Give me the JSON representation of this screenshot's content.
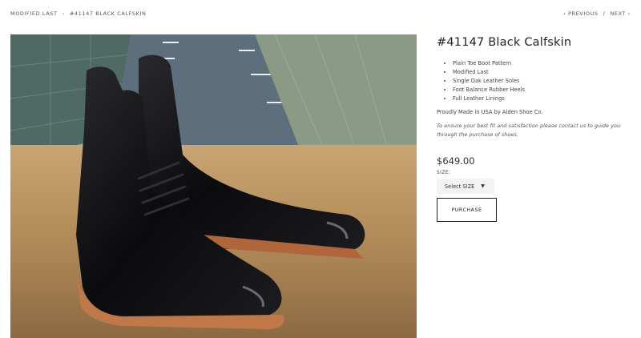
{
  "breadcrumb": {
    "parent": "MODIFIED LAST",
    "separator": "›",
    "current": "#41147 BLACK CALFSKIN"
  },
  "pager": {
    "previous": "‹ PREVIOUS",
    "separator": "/",
    "next": "NEXT ›"
  },
  "product": {
    "title": "#41147 Black Calfskin",
    "features": [
      "Plain Toe Boot Pattern",
      "Modified Last",
      "Single Oak Leather Soles",
      "Foot Balance Rubber Heels",
      "Full Leather Linings"
    ],
    "made_in": "Proudly Made in USA by Alden Shoe Co.",
    "note": "To ensure your best fit and satisfaction please contact us to guide you through the purchase of shoes.",
    "price": "$649.00",
    "size_label": "SIZE:",
    "size_select": "Select SIZE",
    "purchase_label": "PURCHASE"
  },
  "icons": {
    "dropdown": "caret-down-icon"
  },
  "colors": {
    "text": "#333333",
    "button_border": "#222222",
    "select_bg": "#f3f3f3"
  }
}
